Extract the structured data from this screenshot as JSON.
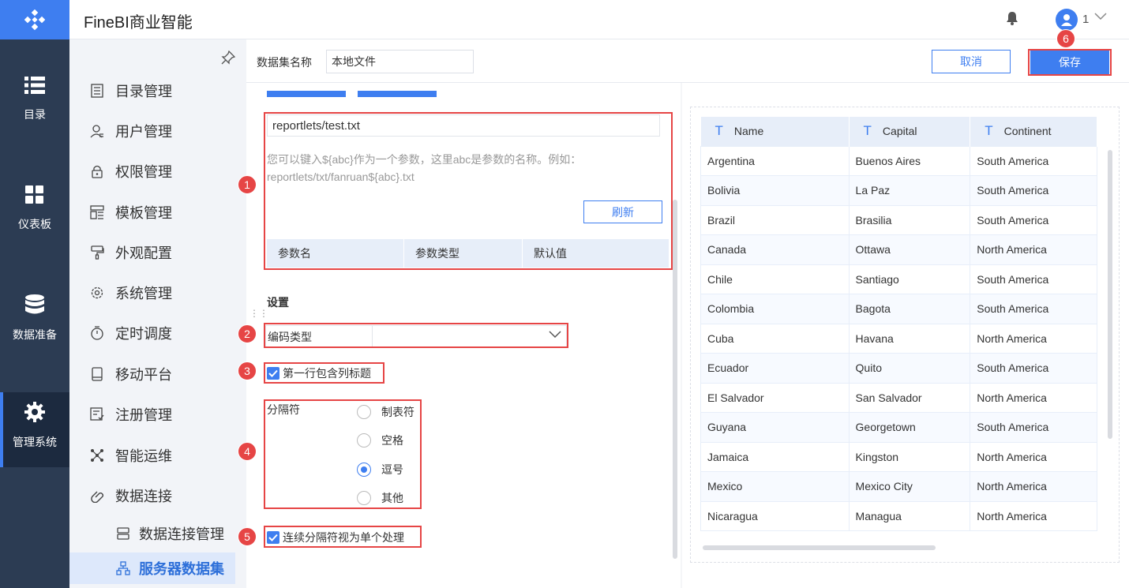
{
  "colors": {
    "accent": "#3e7ef0",
    "sidebar_dark": "#2c3c53",
    "annotation_red": "#e64545"
  },
  "header": {
    "title": "FineBI商业智能",
    "user_name": "1"
  },
  "iconbar": {
    "items": [
      {
        "label": "目录",
        "icon": "list-icon"
      },
      {
        "label": "仪表板",
        "icon": "dashboard-icon"
      },
      {
        "label": "数据准备",
        "icon": "database-icon"
      },
      {
        "label": "管理系统",
        "icon": "gear-icon"
      }
    ]
  },
  "sidebar": {
    "items": [
      {
        "label": "目录管理",
        "icon": "catalog-icon"
      },
      {
        "label": "用户管理",
        "icon": "user-icon"
      },
      {
        "label": "权限管理",
        "icon": "lock-icon"
      },
      {
        "label": "模板管理",
        "icon": "template-icon"
      },
      {
        "label": "外观配置",
        "icon": "brush-icon"
      },
      {
        "label": "系统管理",
        "icon": "settings-icon"
      },
      {
        "label": "定时调度",
        "icon": "timer-icon"
      },
      {
        "label": "移动平台",
        "icon": "mobile-icon"
      },
      {
        "label": "注册管理",
        "icon": "register-icon"
      },
      {
        "label": "智能运维",
        "icon": "network-icon"
      },
      {
        "label": "数据连接",
        "icon": "link-icon"
      }
    ],
    "subitems": [
      {
        "label": "数据连接管理",
        "icon": "server-icon"
      },
      {
        "label": "服务器数据集",
        "icon": "dataset-tree-icon"
      }
    ]
  },
  "topbar": {
    "dataset_name_label": "数据集名称",
    "dataset_name_value": "本地文件",
    "cancel_label": "取消",
    "save_label": "保存"
  },
  "form": {
    "file_path": "reportlets/test.txt",
    "hint": "您可以键入${abc}作为一个参数，这里abc是参数的名称。例如：reportlets/txt/fanruan${abc}.txt",
    "refresh_label": "刷新",
    "param_headers": [
      "参数名",
      "参数类型",
      "默认值"
    ],
    "settings_title": "设置",
    "encoding_label": "编码类型",
    "encoding_value": "",
    "first_row_header_label": "第一行包含列标题",
    "first_row_header_checked": true,
    "delimiter_label": "分隔符",
    "delimiters": [
      {
        "label": "制表符",
        "selected": false
      },
      {
        "label": "空格",
        "selected": false
      },
      {
        "label": "逗号",
        "selected": true
      },
      {
        "label": "其他",
        "selected": false
      }
    ],
    "merge_delimiters_label": "连续分隔符视为单个处理",
    "merge_delimiters_checked": true
  },
  "annotations": [
    "1",
    "2",
    "3",
    "4",
    "5",
    "6"
  ],
  "preview": {
    "columns": [
      "Name",
      "Capital",
      "Continent"
    ],
    "column_type_icon": "text-type-icon",
    "rows": [
      [
        "Argentina",
        "Buenos Aires",
        "South America"
      ],
      [
        "Bolivia",
        "La Paz",
        "South America"
      ],
      [
        "Brazil",
        "Brasilia",
        "South America"
      ],
      [
        "Canada",
        "Ottawa",
        "North America"
      ],
      [
        "Chile",
        "Santiago",
        "South America"
      ],
      [
        "Colombia",
        "Bagota",
        "South America"
      ],
      [
        "Cuba",
        "Havana",
        "North America"
      ],
      [
        "Ecuador",
        "Quito",
        "South America"
      ],
      [
        "El Salvador",
        "San Salvador",
        "North America"
      ],
      [
        "Guyana",
        "Georgetown",
        "South America"
      ],
      [
        "Jamaica",
        "Kingston",
        "North America"
      ],
      [
        "Mexico",
        "Mexico City",
        "North America"
      ],
      [
        "Nicaragua",
        "Managua",
        "North America"
      ]
    ]
  }
}
